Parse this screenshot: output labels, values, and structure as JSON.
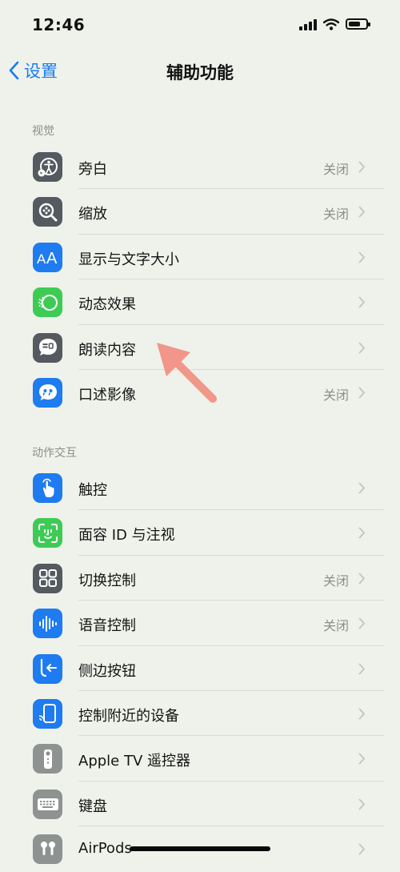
{
  "status": {
    "time": "12:46",
    "battery_level": 0.7
  },
  "nav": {
    "back_label": "设置",
    "title": "辅助功能"
  },
  "sections": [
    {
      "header": "视觉",
      "items": [
        {
          "label": "旁白",
          "value": "关闭",
          "icon": "voiceover-icon",
          "color": "#555a60"
        },
        {
          "label": "缩放",
          "value": "关闭",
          "icon": "zoom-icon",
          "color": "#555a60"
        },
        {
          "label": "显示与文字大小",
          "value": "",
          "icon": "text-size-icon",
          "color": "#1e7bf0"
        },
        {
          "label": "动态效果",
          "value": "",
          "icon": "motion-icon",
          "color": "#3ecb55"
        },
        {
          "label": "朗读内容",
          "value": "",
          "icon": "spoken-content-icon",
          "color": "#555a60"
        },
        {
          "label": "口述影像",
          "value": "关闭",
          "icon": "audio-descriptions-icon",
          "color": "#1e7bf0"
        }
      ]
    },
    {
      "header": "动作交互",
      "items": [
        {
          "label": "触控",
          "value": "",
          "icon": "touch-icon",
          "color": "#1e7bf0"
        },
        {
          "label": "面容 ID 与注视",
          "value": "",
          "icon": "face-id-icon",
          "color": "#3ecb55"
        },
        {
          "label": "切换控制",
          "value": "关闭",
          "icon": "switch-control-icon",
          "color": "#555a60"
        },
        {
          "label": "语音控制",
          "value": "关闭",
          "icon": "voice-control-icon",
          "color": "#1e7bf0"
        },
        {
          "label": "侧边按钮",
          "value": "",
          "icon": "side-button-icon",
          "color": "#1e7bf0"
        },
        {
          "label": "控制附近的设备",
          "value": "",
          "icon": "nearby-devices-icon",
          "color": "#1e7bf0"
        },
        {
          "label": "Apple TV 遥控器",
          "value": "",
          "icon": "apple-tv-remote-icon",
          "color": "#8e9290"
        },
        {
          "label": "键盘",
          "value": "",
          "icon": "keyboard-icon",
          "color": "#8e9290"
        },
        {
          "label": "AirPods",
          "value": "",
          "icon": "airpods-icon",
          "color": "#8e9290"
        }
      ]
    }
  ]
}
